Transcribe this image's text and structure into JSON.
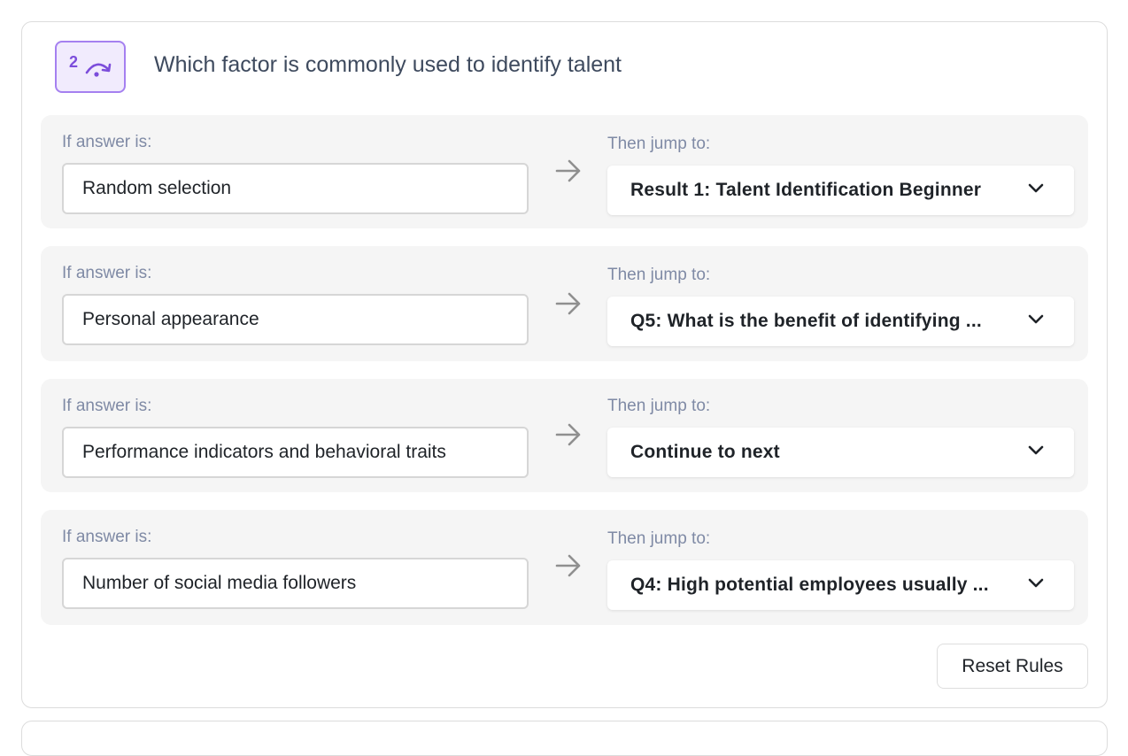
{
  "question": {
    "number": "2",
    "title": "Which factor is commonly used to identify talent",
    "badge_icon": "skip-jump-icon",
    "accent_color": "#7c4ddb"
  },
  "labels": {
    "if_answer": "If answer is:",
    "then_jump": "Then jump to:"
  },
  "rules": [
    {
      "answer": "Random selection",
      "jump_to": "Result 1: Talent Identification Beginner"
    },
    {
      "answer": "Personal appearance",
      "jump_to": "Q5: What is the benefit of identifying ..."
    },
    {
      "answer": "Performance indicators and behavioral traits",
      "jump_to": "Continue to next"
    },
    {
      "answer": "Number of social media followers",
      "jump_to": "Q4: High potential employees usually ..."
    }
  ],
  "actions": {
    "reset_label": "Reset Rules"
  }
}
